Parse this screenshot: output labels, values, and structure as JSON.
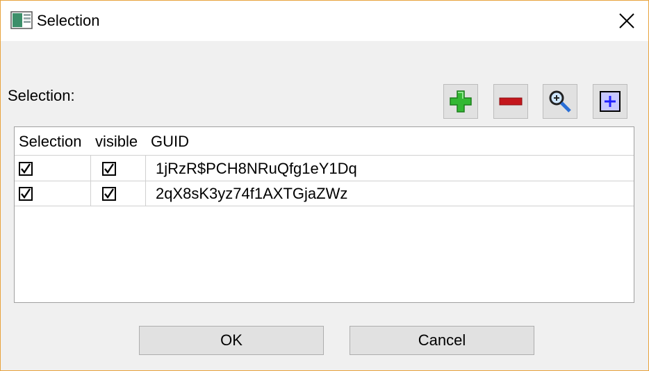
{
  "window": {
    "title": "Selection"
  },
  "section_label": "Selection:",
  "toolbar": {
    "buttons": [
      {
        "icon": "add-icon",
        "color": "#2fb12f"
      },
      {
        "icon": "remove-icon",
        "color": "#c4161c"
      },
      {
        "icon": "zoom-icon",
        "color": "#2a6fd6"
      },
      {
        "icon": "frame-add-icon",
        "color": "#3b3bff"
      }
    ]
  },
  "table": {
    "columns": [
      "Selection",
      "visible",
      "GUID"
    ],
    "rows": [
      {
        "selection": true,
        "visible": true,
        "guid": "1jRzR$PCH8NRuQfg1eY1Dq"
      },
      {
        "selection": true,
        "visible": true,
        "guid": "2qX8sK3yz74f1AXTGjaZWz"
      }
    ]
  },
  "footer": {
    "ok_label": "OK",
    "cancel_label": "Cancel"
  }
}
